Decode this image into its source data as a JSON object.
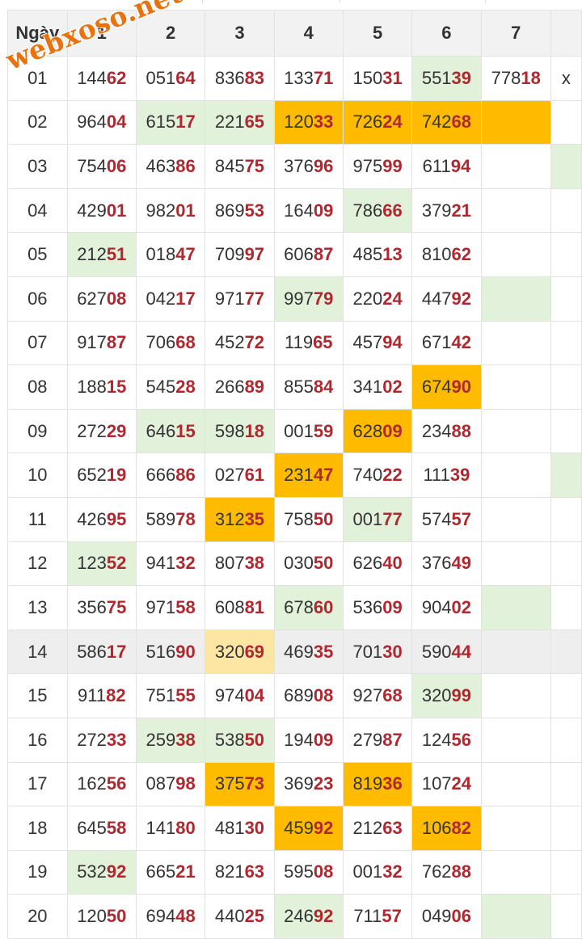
{
  "header": {
    "day_label": "Ngày",
    "columns": [
      "1",
      "2",
      "3",
      "4",
      "5",
      "6",
      "7",
      ""
    ]
  },
  "watermark": "webxoso.net",
  "colors": {
    "suffix_red": "#b0282f",
    "green_highlight": "#e2f1da",
    "orange_highlight": "#ffbb00",
    "pale_highlight": "#fde6a4"
  },
  "rows": [
    {
      "day": "01",
      "cells": [
        [
          "144",
          "62",
          ""
        ],
        [
          "051",
          "64",
          ""
        ],
        [
          "836",
          "83",
          ""
        ],
        [
          "133",
          "71",
          ""
        ],
        [
          "150",
          "31",
          ""
        ],
        [
          "551",
          "39",
          "green"
        ],
        [
          "778",
          "18",
          ""
        ],
        [
          "x",
          "",
          ""
        ]
      ]
    },
    {
      "day": "02",
      "cells": [
        [
          "964",
          "04",
          ""
        ],
        [
          "615",
          "17",
          "green"
        ],
        [
          "221",
          "65",
          "green"
        ],
        [
          "120",
          "33",
          "orange"
        ],
        [
          "726",
          "24",
          "orange"
        ],
        [
          "742",
          "68",
          "orange"
        ],
        [
          "",
          "",
          "orange"
        ],
        [
          "",
          "",
          ""
        ]
      ]
    },
    {
      "day": "03",
      "cells": [
        [
          "754",
          "06",
          ""
        ],
        [
          "463",
          "86",
          ""
        ],
        [
          "845",
          "75",
          ""
        ],
        [
          "376",
          "96",
          ""
        ],
        [
          "975",
          "99",
          ""
        ],
        [
          "611",
          "94",
          ""
        ],
        [
          "",
          "",
          ""
        ],
        [
          "",
          "",
          "green"
        ]
      ]
    },
    {
      "day": "04",
      "cells": [
        [
          "429",
          "01",
          ""
        ],
        [
          "982",
          "01",
          ""
        ],
        [
          "869",
          "53",
          ""
        ],
        [
          "164",
          "09",
          ""
        ],
        [
          "786",
          "66",
          "green"
        ],
        [
          "379",
          "21",
          ""
        ],
        [
          "",
          "",
          ""
        ],
        [
          "",
          "",
          ""
        ]
      ]
    },
    {
      "day": "05",
      "cells": [
        [
          "212",
          "51",
          "green"
        ],
        [
          "018",
          "47",
          ""
        ],
        [
          "709",
          "97",
          ""
        ],
        [
          "606",
          "87",
          ""
        ],
        [
          "485",
          "13",
          ""
        ],
        [
          "810",
          "62",
          ""
        ],
        [
          "",
          "",
          ""
        ],
        [
          "",
          "",
          ""
        ]
      ]
    },
    {
      "day": "06",
      "cells": [
        [
          "627",
          "08",
          ""
        ],
        [
          "042",
          "17",
          ""
        ],
        [
          "971",
          "77",
          ""
        ],
        [
          "997",
          "79",
          "green"
        ],
        [
          "220",
          "24",
          ""
        ],
        [
          "447",
          "92",
          ""
        ],
        [
          "",
          "",
          "green"
        ],
        [
          "",
          "",
          ""
        ]
      ]
    },
    {
      "day": "07",
      "cells": [
        [
          "917",
          "87",
          ""
        ],
        [
          "706",
          "68",
          ""
        ],
        [
          "452",
          "72",
          ""
        ],
        [
          "119",
          "65",
          ""
        ],
        [
          "457",
          "94",
          ""
        ],
        [
          "671",
          "42",
          ""
        ],
        [
          "",
          "",
          ""
        ],
        [
          "",
          "",
          ""
        ]
      ]
    },
    {
      "day": "08",
      "cells": [
        [
          "188",
          "15",
          ""
        ],
        [
          "545",
          "28",
          ""
        ],
        [
          "266",
          "89",
          ""
        ],
        [
          "855",
          "84",
          ""
        ],
        [
          "341",
          "02",
          ""
        ],
        [
          "674",
          "90",
          "orange"
        ],
        [
          "",
          "",
          ""
        ],
        [
          "",
          "",
          ""
        ]
      ]
    },
    {
      "day": "09",
      "cells": [
        [
          "272",
          "29",
          ""
        ],
        [
          "646",
          "15",
          "green"
        ],
        [
          "598",
          "18",
          "green"
        ],
        [
          "001",
          "59",
          ""
        ],
        [
          "628",
          "09",
          "orange"
        ],
        [
          "234",
          "88",
          ""
        ],
        [
          "",
          "",
          ""
        ],
        [
          "",
          "",
          ""
        ]
      ]
    },
    {
      "day": "10",
      "cells": [
        [
          "652",
          "19",
          ""
        ],
        [
          "666",
          "86",
          ""
        ],
        [
          "027",
          "61",
          ""
        ],
        [
          "231",
          "47",
          "orange"
        ],
        [
          "740",
          "22",
          ""
        ],
        [
          "111",
          "39",
          ""
        ],
        [
          "",
          "",
          ""
        ],
        [
          "",
          "",
          "green"
        ]
      ]
    },
    {
      "day": "11",
      "cells": [
        [
          "426",
          "95",
          ""
        ],
        [
          "589",
          "78",
          ""
        ],
        [
          "312",
          "35",
          "orange"
        ],
        [
          "758",
          "50",
          ""
        ],
        [
          "001",
          "77",
          "green"
        ],
        [
          "574",
          "57",
          ""
        ],
        [
          "",
          "",
          ""
        ],
        [
          "",
          "",
          ""
        ]
      ]
    },
    {
      "day": "12",
      "cells": [
        [
          "123",
          "52",
          "green"
        ],
        [
          "941",
          "32",
          ""
        ],
        [
          "807",
          "38",
          ""
        ],
        [
          "030",
          "50",
          ""
        ],
        [
          "626",
          "40",
          ""
        ],
        [
          "376",
          "49",
          ""
        ],
        [
          "",
          "",
          ""
        ],
        [
          "",
          "",
          ""
        ]
      ]
    },
    {
      "day": "13",
      "cells": [
        [
          "356",
          "75",
          ""
        ],
        [
          "971",
          "58",
          ""
        ],
        [
          "608",
          "81",
          ""
        ],
        [
          "678",
          "60",
          "green"
        ],
        [
          "536",
          "09",
          ""
        ],
        [
          "904",
          "02",
          ""
        ],
        [
          "",
          "",
          "green"
        ],
        [
          "",
          "",
          ""
        ]
      ]
    },
    {
      "day": "14",
      "highlight": true,
      "cells": [
        [
          "586",
          "17",
          ""
        ],
        [
          "516",
          "90",
          ""
        ],
        [
          "320",
          "69",
          "pale"
        ],
        [
          "469",
          "35",
          ""
        ],
        [
          "701",
          "30",
          ""
        ],
        [
          "590",
          "44",
          ""
        ],
        [
          "",
          "",
          ""
        ],
        [
          "",
          "",
          ""
        ]
      ]
    },
    {
      "day": "15",
      "cells": [
        [
          "911",
          "82",
          ""
        ],
        [
          "751",
          "55",
          ""
        ],
        [
          "974",
          "04",
          ""
        ],
        [
          "689",
          "08",
          ""
        ],
        [
          "927",
          "68",
          ""
        ],
        [
          "320",
          "99",
          "green"
        ],
        [
          "",
          "",
          ""
        ],
        [
          "",
          "",
          ""
        ]
      ]
    },
    {
      "day": "16",
      "cells": [
        [
          "272",
          "33",
          ""
        ],
        [
          "259",
          "38",
          "green"
        ],
        [
          "538",
          "50",
          "green"
        ],
        [
          "194",
          "09",
          ""
        ],
        [
          "279",
          "87",
          ""
        ],
        [
          "124",
          "56",
          ""
        ],
        [
          "",
          "",
          ""
        ],
        [
          "",
          "",
          ""
        ]
      ]
    },
    {
      "day": "17",
      "cells": [
        [
          "162",
          "56",
          ""
        ],
        [
          "087",
          "98",
          ""
        ],
        [
          "375",
          "73",
          "orange"
        ],
        [
          "369",
          "23",
          ""
        ],
        [
          "819",
          "36",
          "orange"
        ],
        [
          "107",
          "24",
          ""
        ],
        [
          "",
          "",
          ""
        ],
        [
          "",
          "",
          ""
        ]
      ]
    },
    {
      "day": "18",
      "cells": [
        [
          "645",
          "58",
          ""
        ],
        [
          "141",
          "80",
          ""
        ],
        [
          "481",
          "30",
          ""
        ],
        [
          "459",
          "92",
          "orange"
        ],
        [
          "212",
          "63",
          ""
        ],
        [
          "106",
          "82",
          "orange"
        ],
        [
          "",
          "",
          ""
        ],
        [
          "",
          "",
          ""
        ]
      ]
    },
    {
      "day": "19",
      "cells": [
        [
          "532",
          "92",
          "green"
        ],
        [
          "665",
          "21",
          ""
        ],
        [
          "821",
          "63",
          ""
        ],
        [
          "595",
          "08",
          ""
        ],
        [
          "001",
          "32",
          ""
        ],
        [
          "762",
          "88",
          ""
        ],
        [
          "",
          "",
          ""
        ],
        [
          "",
          "",
          ""
        ]
      ]
    },
    {
      "day": "20",
      "cells": [
        [
          "120",
          "50",
          ""
        ],
        [
          "694",
          "48",
          ""
        ],
        [
          "440",
          "25",
          ""
        ],
        [
          "246",
          "92",
          "green"
        ],
        [
          "711",
          "57",
          ""
        ],
        [
          "049",
          "06",
          ""
        ],
        [
          "",
          "",
          "green"
        ],
        [
          "",
          "",
          ""
        ]
      ]
    }
  ]
}
